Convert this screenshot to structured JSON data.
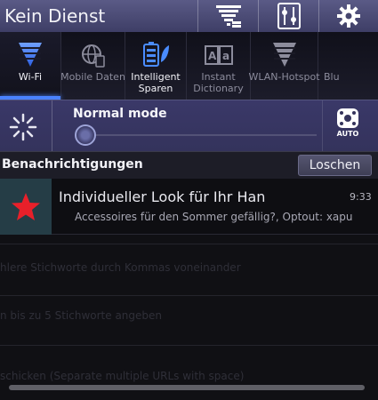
{
  "topbar": {
    "title": "Kein Dienst",
    "icons": [
      "notification-filter-icon",
      "equalizer-settings-icon",
      "gear-icon"
    ]
  },
  "toggles": [
    {
      "label": "Wi-Fi",
      "icon": "wifi-icon",
      "state": "on",
      "selected": true
    },
    {
      "label": "Mobile Daten",
      "icon": "globe-mobile-data-icon",
      "state": "off"
    },
    {
      "label_line1": "Intelligent",
      "label_line2": "Sparen",
      "icon": "battery-leaf-icon",
      "state": "on"
    },
    {
      "label_line1": "Instant",
      "label_line2": "Dictionary",
      "icon": "dictionary-icon",
      "state": "off"
    },
    {
      "label": "WLAN-Hotspot",
      "icon": "hotspot-icon",
      "state": "off"
    },
    {
      "label": "Blu",
      "icon": "bluetooth-icon",
      "state": "off"
    }
  ],
  "mode_row": {
    "label": "Normal mode",
    "auto_label": "AUTO",
    "brightness_level": 0.0
  },
  "notifications": {
    "header": "Benachrichtigungen",
    "clear_label": "Loschen",
    "items": [
      {
        "title": "Individueller Look für Ihr Han",
        "time": "9:33",
        "text": "Accessoires für den Sommer gefällig?, Optout: xapu",
        "icon": "star-icon"
      }
    ]
  },
  "background": {
    "line1": "hlere Stichworte durch Kommas voneinander",
    "line2": "n bis zu 5 Stichworte angeben",
    "line3": "schicken (Separate multiple URLs with space)"
  },
  "colors": {
    "accent": "#4a82ff",
    "topbar": "#4a4a74",
    "star": "#e8202a"
  }
}
